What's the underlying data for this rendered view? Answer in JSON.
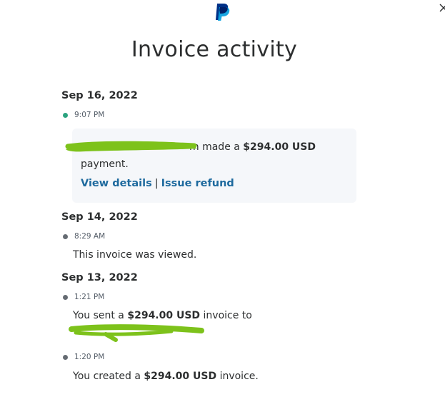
{
  "window": {
    "title": "Invoice activity"
  },
  "icons": {
    "logo": "paypal-logo-icon",
    "close": "close-icon"
  },
  "colors": {
    "brand_blue": "#003087",
    "brand_light_blue": "#009cde",
    "link": "#1e6a9e",
    "event_green": "#2ba37f",
    "event_gray": "#666c73",
    "card_bg": "#f5f7fa",
    "redaction": "#7dc21b"
  },
  "events": [
    {
      "date": "Sep 16, 2022",
      "time": "9:07 PM",
      "status": "green",
      "payer_visible_fragment": "m made a",
      "amount": "$294.00 USD",
      "message_tail": "payment.",
      "links": [
        "View details",
        "Issue refund"
      ],
      "link_separator": "|"
    },
    {
      "date": "Sep 14, 2022",
      "time": "8:29 AM",
      "status": "gray",
      "message": "This invoice was viewed."
    },
    {
      "date": "Sep 13, 2022",
      "time": "1:21 PM",
      "status": "gray",
      "prefix": "You sent a",
      "amount": "$294.00 USD",
      "suffix": "invoice to"
    },
    {
      "time": "1:20 PM",
      "status": "gray",
      "prefix": "You created a",
      "amount": "$294.00 USD",
      "suffix": "invoice."
    }
  ]
}
